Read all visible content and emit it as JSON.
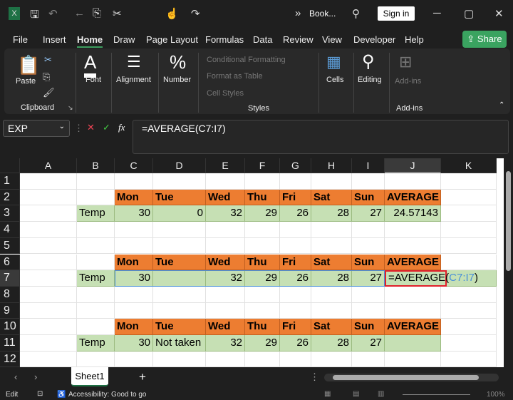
{
  "titlebar": {
    "doc_title": "Book...",
    "sign_in": "Sign in",
    "overflow": "»"
  },
  "menu": [
    "File",
    "Insert",
    "Home",
    "Draw",
    "Page Layout",
    "Formulas",
    "Data",
    "Review",
    "View",
    "Developer",
    "Help"
  ],
  "share": "Share",
  "ribbon": {
    "paste": "Paste",
    "clipboard": "Clipboard",
    "font": "Font",
    "alignment": "Alignment",
    "number": "Number",
    "conditional": "Conditional Formatting",
    "format_table": "Format as Table",
    "cell_styles": "Cell Styles",
    "styles": "Styles",
    "cells": "Cells",
    "editing": "Editing",
    "addins_btn": "Add-ins",
    "addins": "Add-ins"
  },
  "formula_bar": {
    "name_box": "EXP",
    "fx": "fx",
    "formula": "=AVERAGE(C7:I7)"
  },
  "columns": [
    "A",
    "B",
    "C",
    "D",
    "E",
    "F",
    "G",
    "H",
    "I",
    "J",
    "K"
  ],
  "rows": [
    "1",
    "2",
    "3",
    "4",
    "5",
    "6",
    "7",
    "8",
    "9",
    "10",
    "11",
    "12"
  ],
  "selected": {
    "column": "J",
    "row": "7"
  },
  "colors": {
    "header_fill": "#ED7D31",
    "data_fill": "#C6E0B4",
    "edit_border": "#E0202A",
    "ref_color": "#4A90D9"
  },
  "cells": [
    {
      "r": 2,
      "c": 2,
      "t": "Mon",
      "f": "header"
    },
    {
      "r": 2,
      "c": 3,
      "t": "Tue",
      "f": "header"
    },
    {
      "r": 2,
      "c": 4,
      "t": "Wed",
      "f": "header"
    },
    {
      "r": 2,
      "c": 5,
      "t": "Thu",
      "f": "header"
    },
    {
      "r": 2,
      "c": 6,
      "t": "Fri",
      "f": "header"
    },
    {
      "r": 2,
      "c": 7,
      "t": "Sat",
      "f": "header"
    },
    {
      "r": 2,
      "c": 8,
      "t": "Sun",
      "f": "header"
    },
    {
      "r": 2,
      "c": 9,
      "t": "AVERAGE",
      "f": "header"
    },
    {
      "r": 3,
      "c": 1,
      "t": "Temp",
      "f": "data"
    },
    {
      "r": 3,
      "c": 2,
      "t": "30",
      "f": "data",
      "n": 1
    },
    {
      "r": 3,
      "c": 3,
      "t": "0",
      "f": "data",
      "n": 1
    },
    {
      "r": 3,
      "c": 4,
      "t": "32",
      "f": "data",
      "n": 1
    },
    {
      "r": 3,
      "c": 5,
      "t": "29",
      "f": "data",
      "n": 1
    },
    {
      "r": 3,
      "c": 6,
      "t": "26",
      "f": "data",
      "n": 1
    },
    {
      "r": 3,
      "c": 7,
      "t": "28",
      "f": "data",
      "n": 1
    },
    {
      "r": 3,
      "c": 8,
      "t": "27",
      "f": "data",
      "n": 1
    },
    {
      "r": 3,
      "c": 9,
      "t": "24.57143",
      "f": "data",
      "n": 1
    },
    {
      "r": 6,
      "c": 2,
      "t": "Mon",
      "f": "header"
    },
    {
      "r": 6,
      "c": 3,
      "t": "Tue",
      "f": "header"
    },
    {
      "r": 6,
      "c": 4,
      "t": "Wed",
      "f": "header"
    },
    {
      "r": 6,
      "c": 5,
      "t": "Thu",
      "f": "header"
    },
    {
      "r": 6,
      "c": 6,
      "t": "Fri",
      "f": "header"
    },
    {
      "r": 6,
      "c": 7,
      "t": "Sat",
      "f": "header"
    },
    {
      "r": 6,
      "c": 8,
      "t": "Sun",
      "f": "header"
    },
    {
      "r": 6,
      "c": 9,
      "t": "AVERAGE",
      "f": "header"
    },
    {
      "r": 7,
      "c": 1,
      "t": "Temp",
      "f": "data"
    },
    {
      "r": 7,
      "c": 2,
      "t": "30",
      "f": "data",
      "n": 1
    },
    {
      "r": 7,
      "c": 3,
      "t": "",
      "f": "data"
    },
    {
      "r": 7,
      "c": 4,
      "t": "32",
      "f": "data",
      "n": 1
    },
    {
      "r": 7,
      "c": 5,
      "t": "29",
      "f": "data",
      "n": 1
    },
    {
      "r": 7,
      "c": 6,
      "t": "26",
      "f": "data",
      "n": 1
    },
    {
      "r": 7,
      "c": 7,
      "t": "28",
      "f": "data",
      "n": 1
    },
    {
      "r": 7,
      "c": 8,
      "t": "27",
      "f": "data",
      "n": 1
    },
    {
      "r": 7,
      "c": 10,
      "t": "",
      "f": "data"
    },
    {
      "r": 10,
      "c": 2,
      "t": "Mon",
      "f": "header"
    },
    {
      "r": 10,
      "c": 3,
      "t": "Tue",
      "f": "header"
    },
    {
      "r": 10,
      "c": 4,
      "t": "Wed",
      "f": "header"
    },
    {
      "r": 10,
      "c": 5,
      "t": "Thu",
      "f": "header"
    },
    {
      "r": 10,
      "c": 6,
      "t": "Fri",
      "f": "header"
    },
    {
      "r": 10,
      "c": 7,
      "t": "Sat",
      "f": "header"
    },
    {
      "r": 10,
      "c": 8,
      "t": "Sun",
      "f": "header"
    },
    {
      "r": 10,
      "c": 9,
      "t": "AVERAGE",
      "f": "header"
    },
    {
      "r": 11,
      "c": 1,
      "t": "Temp",
      "f": "data"
    },
    {
      "r": 11,
      "c": 2,
      "t": "30",
      "f": "data",
      "n": 1
    },
    {
      "r": 11,
      "c": 3,
      "t": "Not taken",
      "f": "data"
    },
    {
      "r": 11,
      "c": 4,
      "t": "32",
      "f": "data",
      "n": 1
    },
    {
      "r": 11,
      "c": 5,
      "t": "29",
      "f": "data",
      "n": 1
    },
    {
      "r": 11,
      "c": 6,
      "t": "26",
      "f": "data",
      "n": 1
    },
    {
      "r": 11,
      "c": 7,
      "t": "28",
      "f": "data",
      "n": 1
    },
    {
      "r": 11,
      "c": 8,
      "t": "27",
      "f": "data",
      "n": 1
    },
    {
      "r": 11,
      "c": 9,
      "t": "",
      "f": "data"
    }
  ],
  "editing_cell": {
    "prefix": "=AVERAGE(",
    "ref": "C7:I7",
    "suffix": ")"
  },
  "sheet_tab": "Sheet1",
  "status": {
    "mode": "Edit",
    "accessibility": "Accessibility: Good to go",
    "zoom": "100%"
  }
}
